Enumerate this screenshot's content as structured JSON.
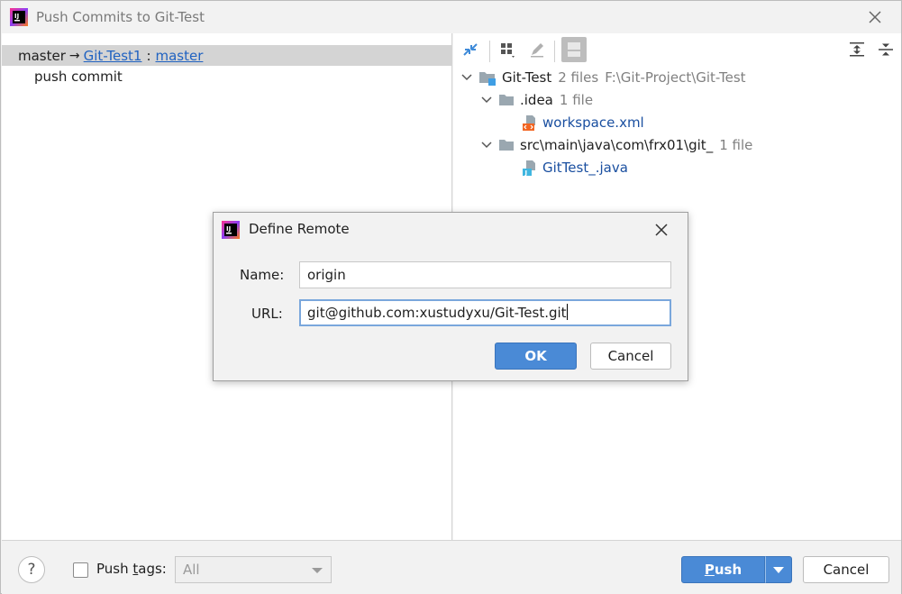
{
  "window": {
    "title": "Push Commits to Git-Test"
  },
  "left": {
    "local_branch": "master",
    "arrow": "→",
    "remote": "Git-Test1",
    "separator": ":",
    "remote_branch": "master",
    "commit_message": "push commit"
  },
  "tree": {
    "root_name": "Git-Test",
    "root_count": "2 files",
    "root_path": "F:\\Git-Project\\Git-Test",
    "folders": [
      {
        "name": ".idea",
        "count": "1 file",
        "file": "workspace.xml"
      },
      {
        "name": "src\\main\\java\\com\\frx01\\git_",
        "count": "1 file",
        "file": "GitTest_.java"
      }
    ]
  },
  "bottom": {
    "help": "?",
    "push_tags_label_prefix": "Push ",
    "push_tags_mnemonic": "t",
    "push_tags_label_suffix": "ags:",
    "tags_select_value": "All",
    "push_mnemonic": "P",
    "push_rest": "ush",
    "cancel_label": "Cancel"
  },
  "dialog": {
    "title": "Define Remote",
    "name_label": "Name:",
    "name_value": "origin",
    "url_label": "URL:",
    "url_value": "git@github.com:xustudyxu/Git-Test.git",
    "ok_label": "OK",
    "cancel_label": "Cancel"
  },
  "colors": {
    "accent": "#4a8ad6",
    "link": "#2062c1",
    "file_link": "#1a4fa0",
    "selection": "#d4d4d4"
  }
}
